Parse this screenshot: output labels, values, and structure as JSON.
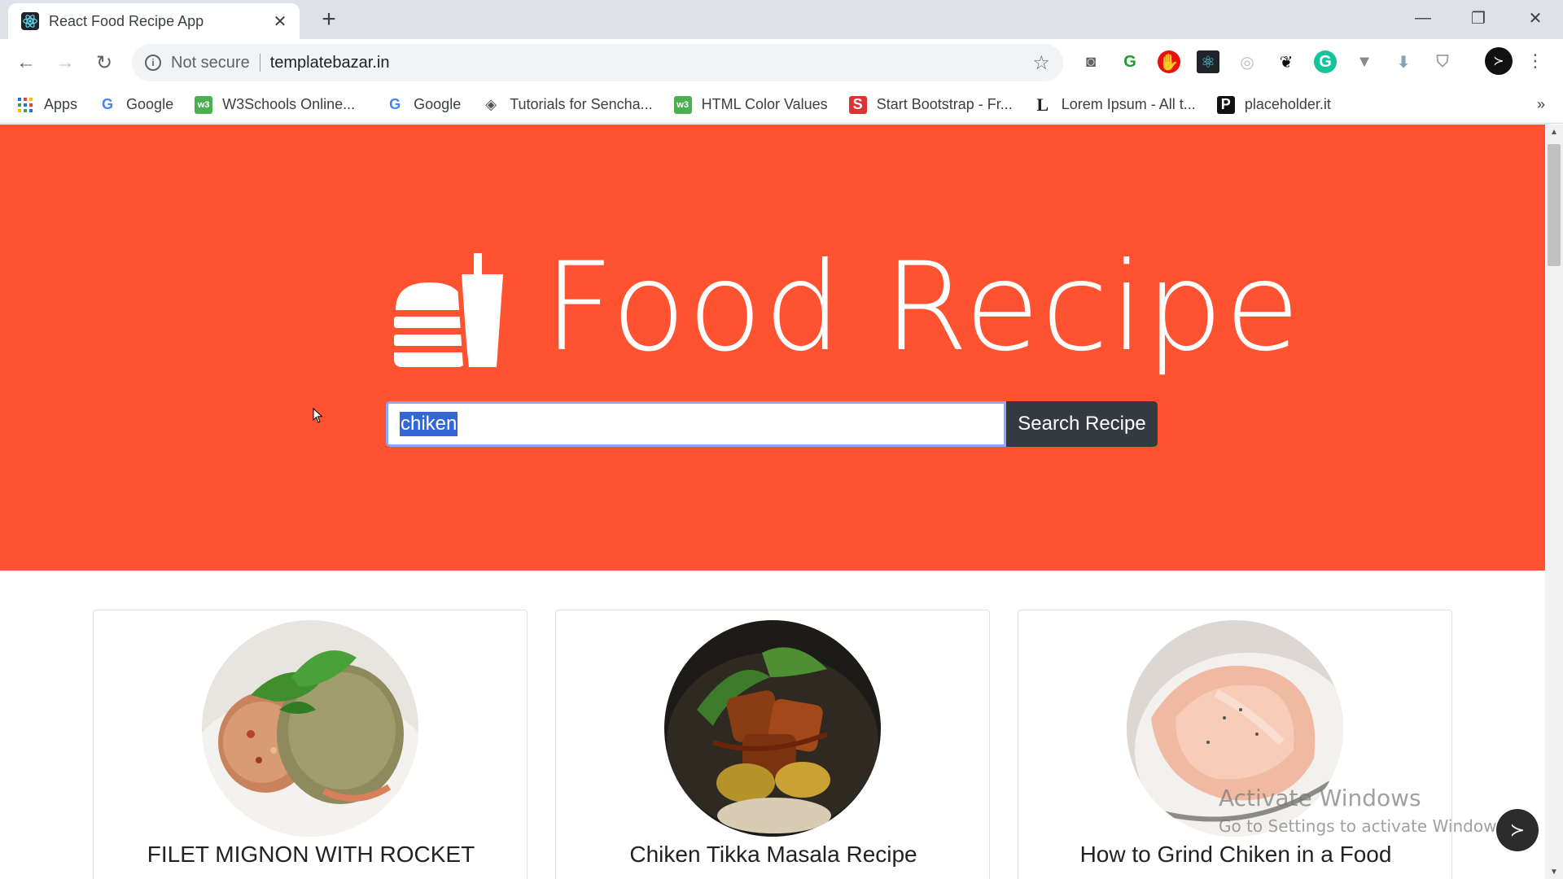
{
  "browser": {
    "tab_title": "React Food Recipe App",
    "new_tab": "+",
    "security_label": "Not secure",
    "url": "templatebazar.in",
    "bookmarks": [
      {
        "label": "Apps",
        "icon": "apps-grid-icon"
      },
      {
        "label": "Google",
        "icon": "google-icon"
      },
      {
        "label": "W3Schools Online...",
        "icon": "w3schools-icon"
      },
      {
        "label": "Google",
        "icon": "google-icon"
      },
      {
        "label": "Tutorials for Sencha...",
        "icon": "sencha-icon"
      },
      {
        "label": "HTML Color Values",
        "icon": "html-color-icon"
      },
      {
        "label": "Start Bootstrap - Fr...",
        "icon": "startbootstrap-icon"
      },
      {
        "label": "Lorem Ipsum - All t...",
        "icon": "lorem-icon"
      },
      {
        "label": "placeholder.it",
        "icon": "placeholder-icon"
      }
    ],
    "more_bookmarks": "»"
  },
  "hero": {
    "title": "Food Recipe",
    "search_value": "chiken",
    "search_button": "Search Recipe"
  },
  "recipes": [
    {
      "title": "FILET MIGNON WITH ROCKET"
    },
    {
      "title": "Chiken Tikka Masala Recipe"
    },
    {
      "title": "How to Grind Chiken in a Food"
    }
  ],
  "watermark": {
    "line1": "Activate Windows",
    "line2": "Go to Settings to activate Windows."
  },
  "colors": {
    "hero_bg": "#ff5231",
    "search_btn_bg": "#343a40",
    "selection": "#3367d6"
  }
}
